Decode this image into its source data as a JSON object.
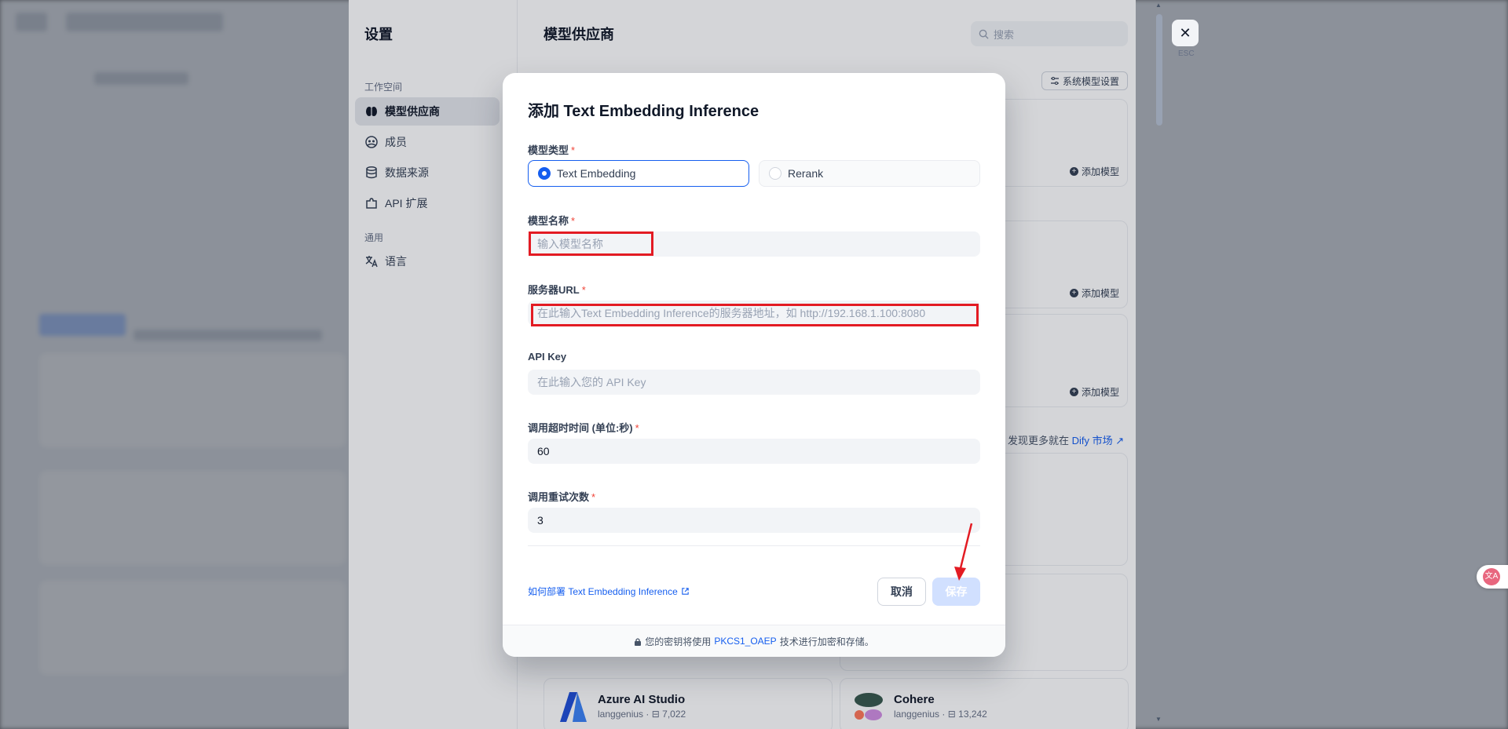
{
  "settings": {
    "title": "设置",
    "workspace_section": "工作空间",
    "general_section": "通用",
    "nav": [
      {
        "label": "模型供应商",
        "icon": "brain-icon"
      },
      {
        "label": "成员",
        "icon": "members-icon"
      },
      {
        "label": "数据来源",
        "icon": "database-icon"
      },
      {
        "label": "API 扩展",
        "icon": "puzzle-icon"
      }
    ],
    "general_nav": [
      {
        "label": "语言",
        "icon": "translate-icon"
      }
    ]
  },
  "main": {
    "title": "模型供应商",
    "search_placeholder": "搜索",
    "system_model_settings": "系统模型设置",
    "add_model": "添加模型",
    "market_prefix": "发现更多就在",
    "market_link": "Dify 市场",
    "bottom_cards": [
      {
        "name": "Azure AI Studio",
        "author": "langgenius",
        "downloads": "7,022"
      },
      {
        "name": "Cohere",
        "author": "langgenius",
        "downloads": "13,242"
      }
    ]
  },
  "close": {
    "label": "ESC"
  },
  "modal": {
    "title": "添加 Text Embedding Inference",
    "model_type": {
      "label": "模型类型",
      "options": [
        "Text Embedding",
        "Rerank"
      ],
      "selected": "Text Embedding"
    },
    "model_name": {
      "label": "模型名称",
      "placeholder": "输入模型名称",
      "value": ""
    },
    "server_url": {
      "label": "服务器URL",
      "placeholder": "在此输入Text Embedding Inference的服务器地址，如 http://192.168.1.100:8080",
      "value": ""
    },
    "api_key": {
      "label": "API Key",
      "placeholder": "在此输入您的 API Key",
      "value": ""
    },
    "timeout": {
      "label": "调用超时时间 (单位:秒)",
      "value": "60"
    },
    "retries": {
      "label": "调用重试次数",
      "value": "3"
    },
    "help_link": "如何部署 Text Embedding Inference",
    "cancel": "取消",
    "save": "保存",
    "footer_prefix": "您的密钥将使用",
    "footer_link": "PKCS1_OAEP",
    "footer_suffix": "技术进行加密和存储。"
  },
  "colors": {
    "accent": "#155eef",
    "required": "#f04438",
    "annotation": "#e31b23"
  }
}
